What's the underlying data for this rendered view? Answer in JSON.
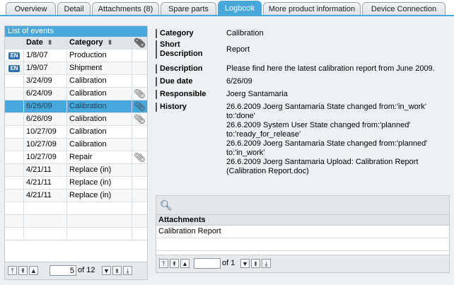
{
  "tabs": [
    {
      "label": "Overview"
    },
    {
      "label": "Detail"
    },
    {
      "label": "Attachments (8)"
    },
    {
      "label": "Spare parts"
    },
    {
      "label": "Logbook",
      "active": true
    },
    {
      "label": "More product information"
    },
    {
      "label": "Device Connection"
    }
  ],
  "events": {
    "title": "List of events",
    "columns": {
      "date": "Date",
      "category": "Category"
    },
    "rows": [
      {
        "badge": "EN",
        "date": "1/8/07",
        "category": "Production",
        "attachment": false
      },
      {
        "badge": "EN",
        "date": "1/9/07",
        "category": "Shipment",
        "attachment": false
      },
      {
        "badge": "",
        "date": "3/24/09",
        "category": "Calibration",
        "attachment": false
      },
      {
        "badge": "",
        "date": "6/24/09",
        "category": "Calibration",
        "attachment": true
      },
      {
        "badge": "",
        "date": "6/26/09",
        "category": "Calibration",
        "attachment": true,
        "selected": true
      },
      {
        "badge": "",
        "date": "6/26/09",
        "category": "Calibration",
        "attachment": true
      },
      {
        "badge": "",
        "date": "10/27/09",
        "category": "Calibration",
        "attachment": false
      },
      {
        "badge": "",
        "date": "10/27/09",
        "category": "Calibration",
        "attachment": false
      },
      {
        "badge": "",
        "date": "10/27/09",
        "category": "Repair",
        "attachment": true
      },
      {
        "badge": "",
        "date": "4/21/11",
        "category": "Replace (in)",
        "attachment": false
      },
      {
        "badge": "",
        "date": "4/21/11",
        "category": "Replace (in)",
        "attachment": false
      },
      {
        "badge": "",
        "date": "4/21/11",
        "category": "Replace (in)",
        "attachment": false
      }
    ],
    "pager": {
      "page": "5",
      "of_text": "of 12"
    }
  },
  "detail": {
    "category": {
      "label": "Category",
      "value": "Calibration"
    },
    "short_description": {
      "label": "Short\nDescription",
      "value": "Report"
    },
    "description": {
      "label": "Description",
      "value": "Please find here the latest calibration report from June 2009."
    },
    "due_date": {
      "label": "Due date",
      "value": "6/26/09"
    },
    "responsible": {
      "label": "Responsible",
      "value": "Joerg Santamaria"
    },
    "history": {
      "label": "History",
      "value": "26.6.2009  Joerg Santamaria  State changed from:'in_work'\nto:'done'\n26.6.2009  System User  State changed from:'planned'\nto:'ready_for_release'\n26.6.2009  Joerg Santamaria  State changed from:'planned'\nto:'in_work'\n26.6.2009  Joerg Santamaria  Upload: Calibration Report\n(Calibration Report.doc)"
    }
  },
  "attachments": {
    "header": "Attachments",
    "rows": [
      "Calibration Report"
    ],
    "pager": {
      "page": "",
      "of_text": "of 1"
    }
  },
  "icons": {
    "badge": "language-en-icon",
    "attachment": "paperclip-icon",
    "search": "magnifier-icon"
  },
  "colors": {
    "accent": "#48a8dc",
    "panel": "#eef1f3"
  }
}
